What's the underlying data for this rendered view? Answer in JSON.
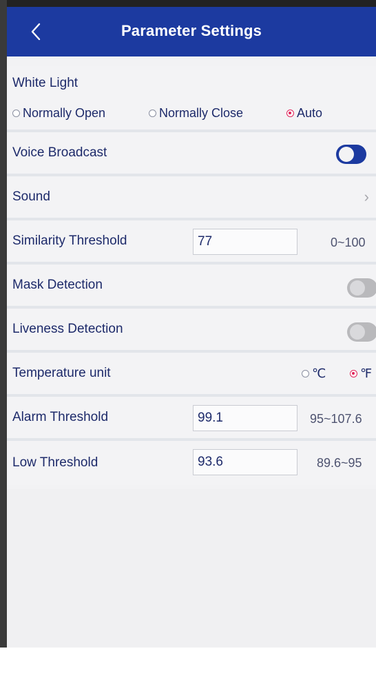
{
  "header": {
    "title": "Parameter Settings",
    "back_icon": "chevron-left-icon"
  },
  "white_light": {
    "label": "White Light",
    "options": [
      "Normally Open",
      "Normally Close",
      "Auto"
    ],
    "selected": "Auto"
  },
  "voice_broadcast": {
    "label": "Voice Broadcast",
    "enabled": true
  },
  "sound": {
    "label": "Sound",
    "icon": "chevron-right-icon"
  },
  "similarity_threshold": {
    "label": "Similarity Threshold",
    "value": "77",
    "range": "0~100"
  },
  "mask_detection": {
    "label": "Mask Detection",
    "enabled": false
  },
  "liveness_detection": {
    "label": "Liveness Detection",
    "enabled": false
  },
  "temperature_unit": {
    "label": "Temperature unit",
    "options": [
      "℃",
      "℉"
    ],
    "selected": "℉"
  },
  "alarm_threshold": {
    "label": "Alarm Threshold",
    "value": "99.1",
    "range": "95~107.6"
  },
  "low_threshold": {
    "label": "Low Threshold",
    "value": "93.6",
    "range": "89.6~95"
  },
  "colors": {
    "header_bg": "#1c3aa0",
    "accent_radio": "#e0245a",
    "toggle_on": "#1c3aa0",
    "toggle_off": "#b9b9bc"
  }
}
